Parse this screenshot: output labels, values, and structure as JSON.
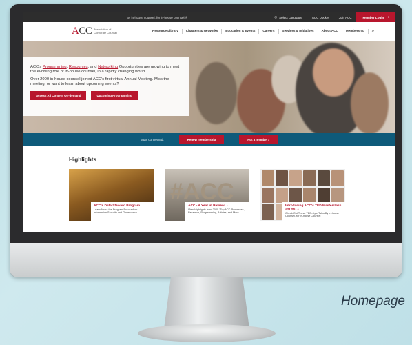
{
  "caption": "Homepage",
  "topbar": {
    "tagline": "By in-house counsel, for in-house counsel.®",
    "select_language": "Select Language",
    "acc_docket": "ACC Docket",
    "join_acc": "Join ACC",
    "member_login": "Member Login"
  },
  "logo": {
    "mark_a": "A",
    "mark_cc": "CC",
    "sub_line1": "Association of",
    "sub_line2": "Corporate Counsel"
  },
  "nav": [
    "Resource Library",
    "Chapters & Networks",
    "Education & Events",
    "Careers",
    "Services & Initiatives",
    "About ACC",
    "Membership"
  ],
  "hero": {
    "p1_pre": "ACC's ",
    "p1_link1": "Programming",
    "p1_sep1": ", ",
    "p1_link2": "Resources",
    "p1_sep2": ", and ",
    "p1_link3": "Networking",
    "p1_post": " Opportunities are growing to meet the evolving role of in-house counsel, in a rapidly changing world.",
    "p2": "Over 2000 in-house counsel joined ACC's first virtual Annual Meeting. Miss the meeting, or want to learn about upcoming events?",
    "btn1": "Access All Content On-demand",
    "btn2": "Upcoming Programming"
  },
  "connected": {
    "label": "Stay connected.",
    "btn1": "Renew membership",
    "btn2": "Not a member?"
  },
  "highlights": {
    "title": "Highlights",
    "cards": [
      {
        "title": "ACC's Data Steward Program",
        "desc": "Learn About the Program Focused on Information Security and Governance"
      },
      {
        "title": "ACC - A Year in Review",
        "desc": "View Highlights from 2020 \"Top ACC Resources, Research, Programming, Articles, and More"
      },
      {
        "title": "Introducing ACC's TED Masterclass Series",
        "desc": "Check Out These TED-style Talks By In-house Counsel, for In-house Counsel"
      }
    ]
  },
  "colors": {
    "brand_red": "#b8162d",
    "band_blue": "#0e5a7a"
  }
}
